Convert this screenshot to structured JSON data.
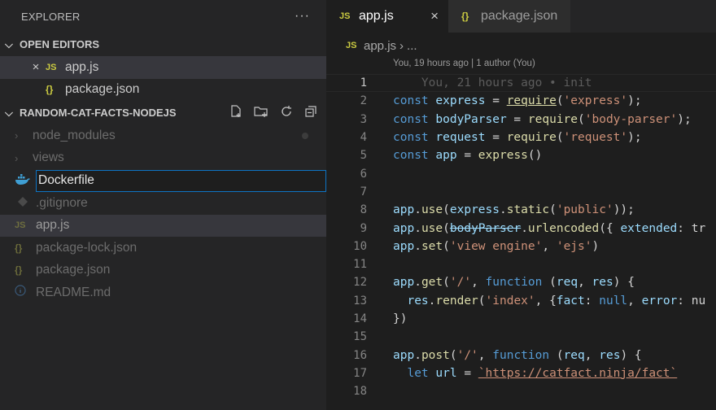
{
  "explorer": {
    "title": "EXPLORER",
    "more": "···",
    "open_editors": {
      "label": "OPEN EDITORS",
      "items": [
        {
          "close": "×",
          "badge": "JS",
          "label": "app.js"
        },
        {
          "badge": "{}",
          "label": "package.json"
        }
      ]
    },
    "project": {
      "label": "RANDOM-CAT-FACTS-NODEJS",
      "actions": [
        "new-file-icon",
        "new-folder-icon",
        "refresh-icon",
        "collapse-all-icon"
      ],
      "items": [
        {
          "label": "node_modules",
          "type": "folder"
        },
        {
          "label": "views",
          "type": "folder"
        },
        {
          "label": ".gitignore",
          "type": "file"
        },
        {
          "label": "app.js",
          "type": "js"
        },
        {
          "label": "package-lock.json",
          "type": "json"
        },
        {
          "label": "package.json",
          "type": "json"
        },
        {
          "label": "README.md",
          "type": "info"
        }
      ],
      "rename_value": "Dockerfile"
    }
  },
  "editor": {
    "tabs": [
      {
        "badge": "JS",
        "label": "app.js",
        "close": "×"
      },
      {
        "badge": "{}",
        "label": "package.json"
      }
    ],
    "breadcrumb": {
      "badge": "JS",
      "file": "app.js",
      "sep": "›",
      "tail": "..."
    },
    "blame": "You, 19 hours ago | 1 author (You)",
    "line_numbers": [
      "1",
      "2",
      "3",
      "4",
      "5",
      "6",
      "7",
      "8",
      "9",
      "10",
      "11",
      "12",
      "13",
      "14",
      "15",
      "16",
      "17",
      "18"
    ],
    "inline_blame": "    You, 21 hours ago • init",
    "code": {
      "l2": [
        "const",
        " ",
        "express",
        " = ",
        "require",
        "(",
        "'express'",
        ");"
      ],
      "l3": [
        "const",
        " ",
        "bodyParser",
        " = ",
        "require",
        "(",
        "'body-parser'",
        ");"
      ],
      "l4": [
        "const",
        " ",
        "request",
        " = ",
        "require",
        "(",
        "'request'",
        ");"
      ],
      "l5": [
        "const",
        " ",
        "app",
        " = ",
        "express",
        "()"
      ],
      "l8": [
        "app",
        ".",
        "use",
        "(",
        "express",
        ".",
        "static",
        "(",
        "'public'",
        "));"
      ],
      "l9": [
        "app",
        ".",
        "use",
        "(",
        "bodyParser",
        ".",
        "urlencoded",
        "({ ",
        "extended",
        ": tr"
      ],
      "l10": [
        "app",
        ".",
        "set",
        "(",
        "'view engine'",
        ", ",
        "'ejs'",
        ")"
      ],
      "l12": [
        "app",
        ".",
        "get",
        "(",
        "'/'",
        ", ",
        "function",
        " (",
        "req",
        ", ",
        "res",
        ") {"
      ],
      "l13": [
        "  ",
        "res",
        ".",
        "render",
        "(",
        "'index'",
        ", {",
        "fact",
        ": ",
        "null",
        ", ",
        "error",
        ": nu"
      ],
      "l14": [
        "})"
      ],
      "l16": [
        "app",
        ".",
        "post",
        "(",
        "'/'",
        ", ",
        "function",
        " (",
        "req",
        ", ",
        "res",
        ") {"
      ],
      "l17": [
        "  ",
        "let",
        " ",
        "url",
        " = ",
        "`https://catfact.ninja/fact`"
      ]
    }
  },
  "colors": {
    "keyword": "#569cd6",
    "variable": "#9cdcfe",
    "function": "#dcdcaa",
    "string": "#ce9178",
    "js_badge": "#cbcb41",
    "focus_border": "#0e74c4"
  }
}
